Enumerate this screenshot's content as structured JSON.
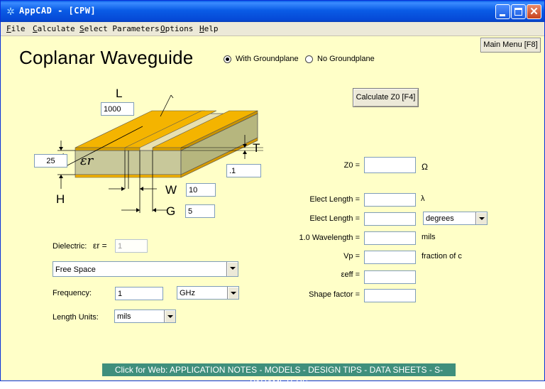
{
  "window": {
    "title": "AppCAD  -  [CPW]",
    "icon": "sparkle-icon"
  },
  "menu": [
    "File",
    "Calculate",
    "Select Parameters",
    "Options",
    "Help"
  ],
  "main_menu_button": "Main Menu [F8]",
  "page_title": "Coplanar Waveguide",
  "groundplane": {
    "options": [
      "With Groundplane",
      "No Groundplane"
    ],
    "selected": "With Groundplane"
  },
  "calculate_button": "Calculate Z0  [F4]",
  "diagram": {
    "labels": {
      "L": "L",
      "H": "H",
      "T": "T",
      "W": "W",
      "G": "G",
      "eps_r": "εr"
    },
    "inputs": {
      "L": "1000",
      "H": "25",
      "T": ".1",
      "W": "10",
      "G": "5"
    },
    "colors": {
      "conductor": "#f4b400",
      "substrate": "#c8c89a",
      "ground": "#f0b000"
    }
  },
  "dielectric": {
    "label": "Dielectric:",
    "eps_label": "εr =",
    "eps_value": "1",
    "material": "Free Space"
  },
  "frequency": {
    "label": "Frequency:",
    "value": "1",
    "unit": "GHz"
  },
  "length_units": {
    "label": "Length Units:",
    "value": "mils"
  },
  "results": [
    {
      "label": "Z0 =",
      "value": "",
      "unit": "Ω"
    },
    {
      "label": "Elect Length =",
      "value": "",
      "unit": "λ"
    },
    {
      "label": "Elect Length =",
      "value": "",
      "unit": "degrees"
    },
    {
      "label": "1.0 Wavelength =",
      "value": "",
      "unit": "mils"
    },
    {
      "label": "Vp =",
      "value": "",
      "unit": "fraction of c"
    },
    {
      "label": "εeff =",
      "value": "",
      "unit": ""
    },
    {
      "label": "Shape factor =",
      "value": "",
      "unit": ""
    }
  ],
  "footer_link": "Click for Web: APPLICATION NOTES - MODELS - DESIGN TIPS - DATA SHEETS - S-PARAMETERS",
  "colors": {
    "background": "#ffffc8",
    "titlebar": "#0a5ce6",
    "footer": "#3f8f7c"
  }
}
